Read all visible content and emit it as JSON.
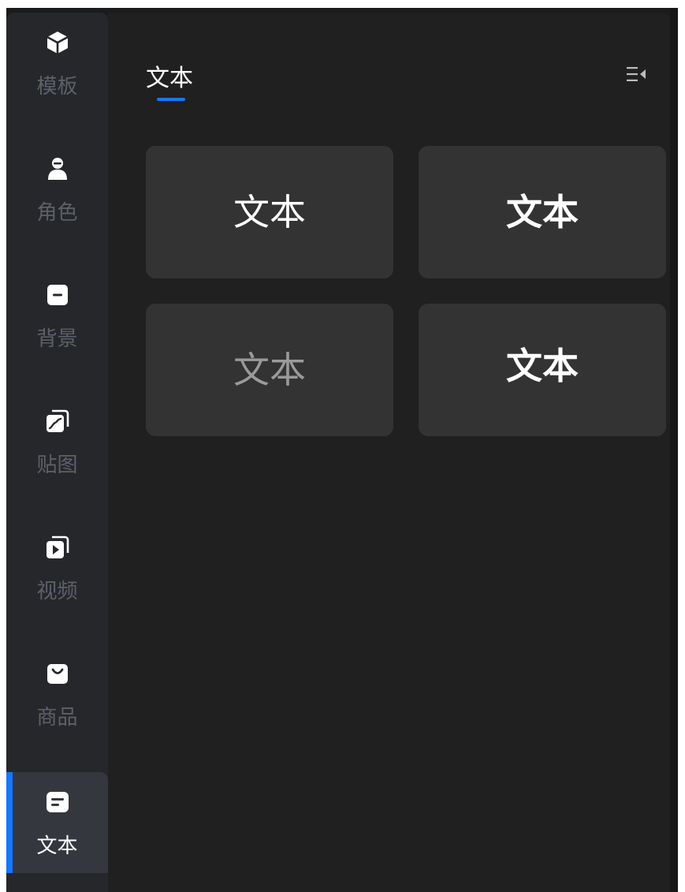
{
  "sidebar": {
    "items": [
      {
        "label": "模板",
        "icon": "template-box-icon",
        "active": false
      },
      {
        "label": "角色",
        "icon": "character-person-icon",
        "active": false
      },
      {
        "label": "背景",
        "icon": "background-icon",
        "active": false
      },
      {
        "label": "贴图",
        "icon": "sticker-image-icon",
        "active": false
      },
      {
        "label": "视频",
        "icon": "video-play-icon",
        "active": false
      },
      {
        "label": "商品",
        "icon": "shopping-bag-icon",
        "active": false
      },
      {
        "label": "文本",
        "icon": "text-icon",
        "active": true
      }
    ]
  },
  "panel": {
    "tab_label": "文本",
    "collapse_icon": "collapse-panel-icon"
  },
  "text_styles": [
    {
      "label": "文本",
      "style": "regular"
    },
    {
      "label": "文本",
      "style": "bold"
    },
    {
      "label": "文本",
      "style": "thin"
    },
    {
      "label": "文本",
      "style": "semibold"
    }
  ],
  "colors": {
    "accent": "#1677ff",
    "sidebar_bg": "#25272b",
    "panel_bg": "#202020",
    "card_bg": "#333333",
    "inactive_label": "#5d6068"
  }
}
